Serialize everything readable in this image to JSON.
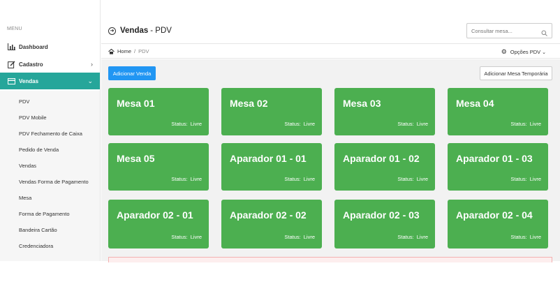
{
  "sidebar": {
    "menu_label": "MENU",
    "items": [
      {
        "label": "Dashboard",
        "icon": "bar-chart-icon"
      },
      {
        "label": "Cadastro",
        "icon": "edit-icon",
        "chevron": "›"
      },
      {
        "label": "Vendas",
        "icon": "credit-card-icon",
        "chevron": "⌄",
        "active": true
      }
    ],
    "submenu": [
      "PDV",
      "PDV Mobile",
      "PDV Fechamento de Caixa",
      "Pedido de Venda",
      "Vendas",
      "Vendas Forma de Pagamento",
      "Mesa",
      "Forma de Pagamento",
      "Bandeira Cartão",
      "Credenciadora"
    ]
  },
  "header": {
    "title_bold": "Vendas",
    "title_rest": "- PDV",
    "search_placeholder": "Consultar mesa..."
  },
  "breadcrumb": {
    "home": "Home",
    "separator": "/",
    "current": "PDV",
    "options_label": "Opções PDV"
  },
  "actions": {
    "add_sale": "Adicionar Venda",
    "add_temp_table": "Adicionar Mesa Temporária"
  },
  "tables": [
    {
      "name": "Mesa 01",
      "status_label": "Status:",
      "status": "Livre"
    },
    {
      "name": "Mesa 02",
      "status_label": "Status:",
      "status": "Livre"
    },
    {
      "name": "Mesa 03",
      "status_label": "Status:",
      "status": "Livre"
    },
    {
      "name": "Mesa 04",
      "status_label": "Status:",
      "status": "Livre"
    },
    {
      "name": "Mesa 05",
      "status_label": "Status:",
      "status": "Livre"
    },
    {
      "name": "Aparador 01 - 01",
      "status_label": "Status:",
      "status": "Livre"
    },
    {
      "name": "Aparador 01 - 02",
      "status_label": "Status:",
      "status": "Livre"
    },
    {
      "name": "Aparador 01 - 03",
      "status_label": "Status:",
      "status": "Livre"
    },
    {
      "name": "Aparador 02 - 01",
      "status_label": "Status:",
      "status": "Livre"
    },
    {
      "name": "Aparador 02 - 02",
      "status_label": "Status:",
      "status": "Livre"
    },
    {
      "name": "Aparador 02 - 03",
      "status_label": "Status:",
      "status": "Livre"
    },
    {
      "name": "Aparador 02 - 04",
      "status_label": "Status:",
      "status": "Livre"
    }
  ],
  "colors": {
    "accent": "#26a69a",
    "primary_button": "#2196f3",
    "table_free": "#4caf50"
  }
}
